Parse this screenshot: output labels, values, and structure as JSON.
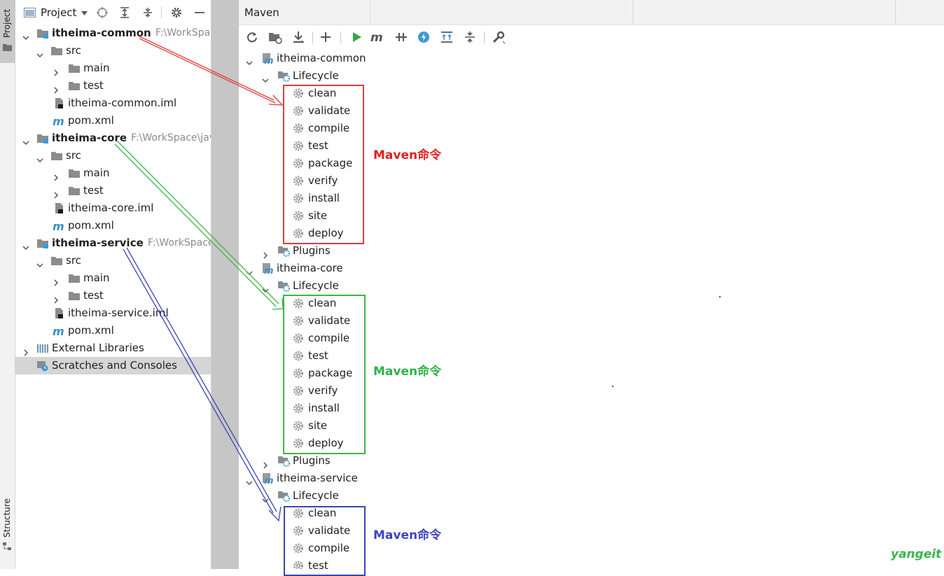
{
  "left_strip": {
    "project_tab": "Project",
    "structure_tab": "Structure"
  },
  "project_panel": {
    "title": "Project",
    "tree": [
      {
        "label": "itheima-common",
        "bold": true,
        "path": "F:\\WorkSpace",
        "icon": "module-folder-icon",
        "chevron": "down",
        "indent": 0
      },
      {
        "label": "src",
        "icon": "folder-icon",
        "chevron": "down",
        "indent": 1
      },
      {
        "label": "main",
        "icon": "folder-icon",
        "chevron": "right",
        "indent": 2
      },
      {
        "label": "test",
        "icon": "folder-icon",
        "chevron": "right",
        "indent": 2
      },
      {
        "label": "itheima-common.iml",
        "icon": "iml-file-icon",
        "indent": 2
      },
      {
        "label": "pom.xml",
        "icon": "maven-m-icon",
        "indent": 2
      },
      {
        "label": "itheima-core",
        "bold": true,
        "path": "F:\\WorkSpace\\jav",
        "icon": "module-folder-icon",
        "chevron": "down",
        "indent": 0
      },
      {
        "label": "src",
        "icon": "folder-icon",
        "chevron": "down",
        "indent": 1
      },
      {
        "label": "main",
        "icon": "folder-icon",
        "chevron": "right",
        "indent": 2
      },
      {
        "label": "test",
        "icon": "folder-icon",
        "chevron": "right",
        "indent": 2
      },
      {
        "label": "itheima-core.iml",
        "icon": "iml-file-icon",
        "indent": 2
      },
      {
        "label": "pom.xml",
        "icon": "maven-m-icon",
        "indent": 2
      },
      {
        "label": "itheima-service",
        "bold": true,
        "path": "F:\\WorkSpace",
        "icon": "module-folder-icon",
        "chevron": "down",
        "indent": 0
      },
      {
        "label": "src",
        "icon": "folder-icon",
        "chevron": "down",
        "indent": 1
      },
      {
        "label": "main",
        "icon": "folder-icon",
        "chevron": "right",
        "indent": 2
      },
      {
        "label": "test",
        "icon": "folder-icon",
        "chevron": "right",
        "indent": 2
      },
      {
        "label": "itheima-service.iml",
        "icon": "iml-file-icon",
        "indent": 2
      },
      {
        "label": "pom.xml",
        "icon": "maven-m-icon",
        "indent": 2
      },
      {
        "label": "External Libraries",
        "icon": "libraries-icon",
        "chevron": "right",
        "indent": 0
      },
      {
        "label": "Scratches and Consoles",
        "icon": "scratches-icon",
        "indent": 0,
        "selected": true
      }
    ]
  },
  "maven_panel": {
    "title": "Maven",
    "projects": [
      {
        "name": "itheima-common",
        "lifecycle_label": "Lifecycle",
        "plugins_label": "Plugins",
        "phases": [
          "clean",
          "validate",
          "compile",
          "test",
          "package",
          "verify",
          "install",
          "site",
          "deploy"
        ]
      },
      {
        "name": "itheima-core",
        "lifecycle_label": "Lifecycle",
        "plugins_label": "Plugins",
        "phases": [
          "clean",
          "validate",
          "compile",
          "test",
          "package",
          "verify",
          "install",
          "site",
          "deploy"
        ]
      },
      {
        "name": "itheima-service",
        "lifecycle_label": "Lifecycle",
        "phases": [
          "clean",
          "validate",
          "compile",
          "test"
        ]
      }
    ]
  },
  "annotations": [
    {
      "text": "Maven命令",
      "color": "#e02020"
    },
    {
      "text": "Maven命令",
      "color": "#2fb24a"
    },
    {
      "text": "Maven命令",
      "color": "#3b45c0"
    }
  ],
  "watermark": "yangeit",
  "colors": {
    "red": "#e23b3b",
    "green": "#3cb54a",
    "blue": "#3b45b5",
    "selected_row": "#d5d5d5",
    "gutter": "#c6c6c6"
  }
}
